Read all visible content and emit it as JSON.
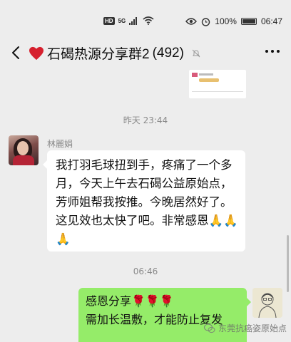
{
  "status_bar": {
    "hd_badge": "HD",
    "network": "5G",
    "battery": "100%",
    "time": "06:47"
  },
  "header": {
    "title": "石碣热源分享群2",
    "member_count": "(492)"
  },
  "chat": {
    "timestamp_1": "昨天 23:44",
    "incoming": {
      "sender": "林麗娟",
      "text": "我打羽毛球扭到手，疼痛了一个多月，今天上午去石碣公益原始点，芳师姐帮我按推。今晚居然好了。这见效也太快了吧。非常感恩🙏🙏🙏"
    },
    "timestamp_2": "06:46",
    "outgoing": {
      "line1": "感恩分享🌹🌹🌹",
      "line2": "需加长温敷，才能防止复发"
    }
  },
  "watermark": "东莞抗癌姿原始点"
}
